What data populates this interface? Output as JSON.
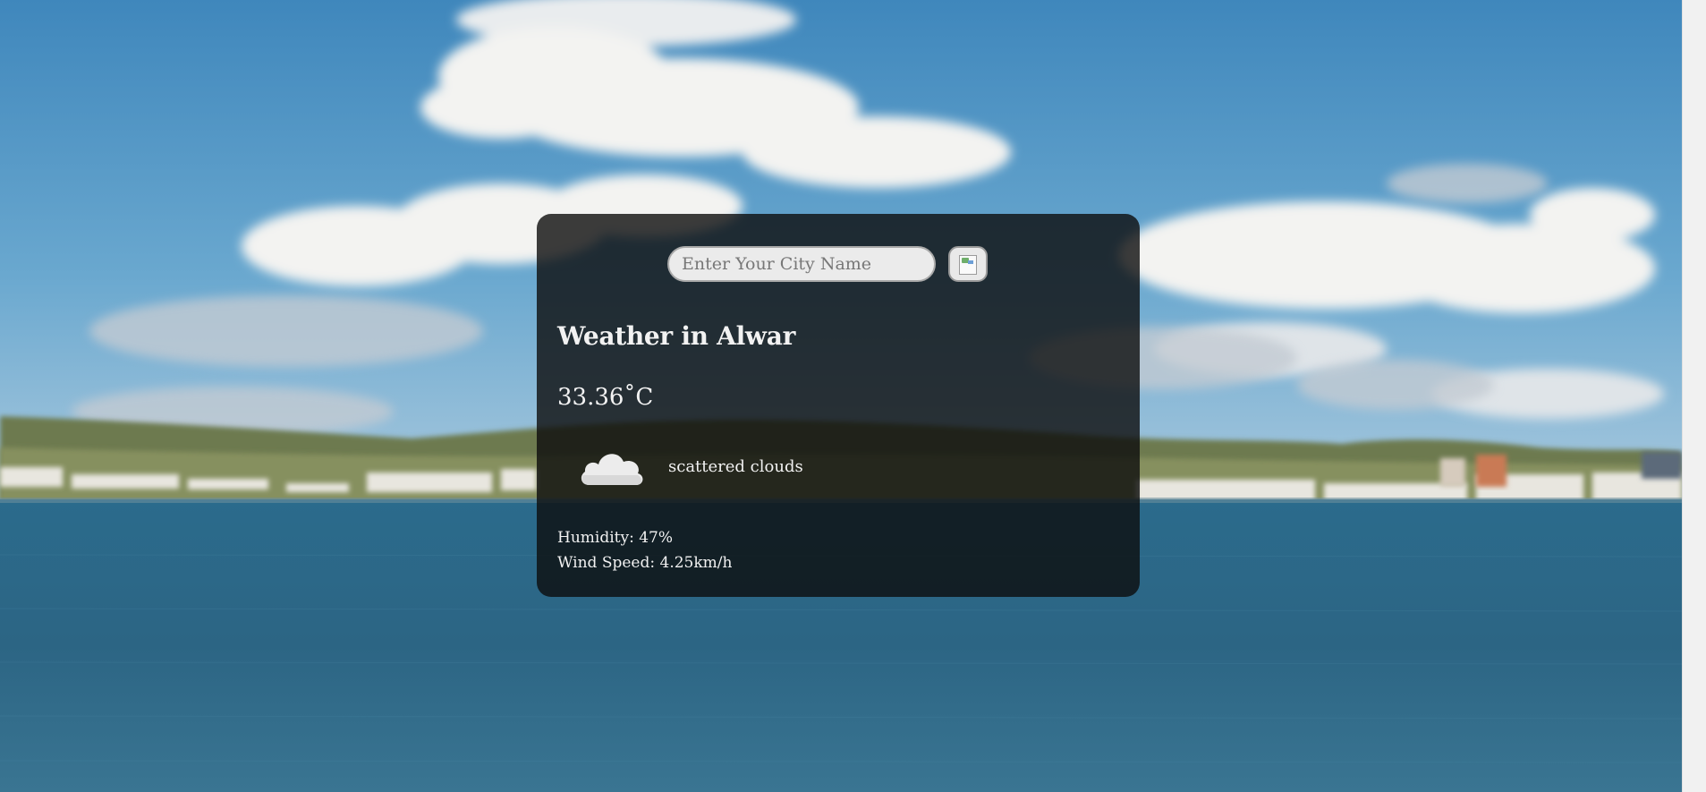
{
  "search": {
    "placeholder": "Enter Your City Name",
    "value": ""
  },
  "search_button": {
    "icon": "broken-image-icon"
  },
  "weather": {
    "title": "Weather in Alwar",
    "temperature": "33.36˚C",
    "condition_icon": "cloud-icon",
    "description": "scattered clouds",
    "humidity": "Humidity: 47%",
    "wind": "Wind Speed: 4.25km/h"
  },
  "colors": {
    "card_background": "#0c0c0c",
    "input_background": "#ebebeb",
    "text": "#f2f2f2",
    "sky": "#5fa1cf",
    "sea": "#2e6885"
  }
}
